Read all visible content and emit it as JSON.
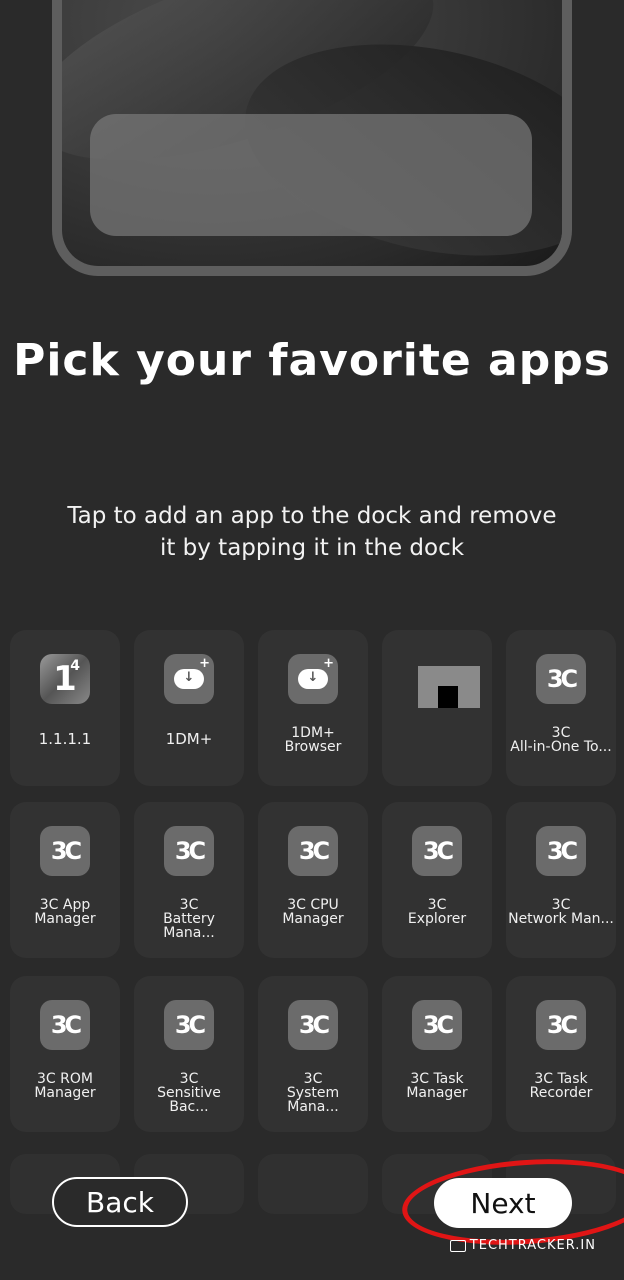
{
  "title": "Pick your favorite apps",
  "subtitle": "Tap to add an app to the dock and remove it by tapping it in the dock",
  "apps": [
    {
      "label": "1.1.1.1",
      "icon": "cloudflare-1111-icon"
    },
    {
      "label": "1DM+",
      "icon": "download-cloud-icon"
    },
    {
      "label": "1DM+\nBrowser",
      "icon": "download-cloud-icon"
    },
    {
      "label": "",
      "icon": "broken-image-icon"
    },
    {
      "label": "3C\nAll-in-One To...",
      "icon": "3c-android-icon"
    },
    {
      "label": "3C App\nManager",
      "icon": "3c-app-manager-icon"
    },
    {
      "label": "3C\nBattery Mana...",
      "icon": "3c-battery-icon"
    },
    {
      "label": "3C CPU\nManager",
      "icon": "3c-cpu-icon"
    },
    {
      "label": "3C\nExplorer",
      "icon": "3c-folder-icon"
    },
    {
      "label": "3C\nNetwork Man...",
      "icon": "3c-network-icon"
    },
    {
      "label": "3C ROM\nManager",
      "icon": "3c-rom-icon"
    },
    {
      "label": "3C\nSensitive Bac...",
      "icon": "3c-backup-icon"
    },
    {
      "label": "3C\nSystem Mana...",
      "icon": "3c-system-icon"
    },
    {
      "label": "3C Task\nManager",
      "icon": "3c-gear-icon"
    },
    {
      "label": "3C Task\nRecorder",
      "icon": "3c-recorder-icon"
    }
  ],
  "buttons": {
    "back": "Back",
    "next": "Next"
  },
  "watermark": "TECHTRACKER.IN"
}
